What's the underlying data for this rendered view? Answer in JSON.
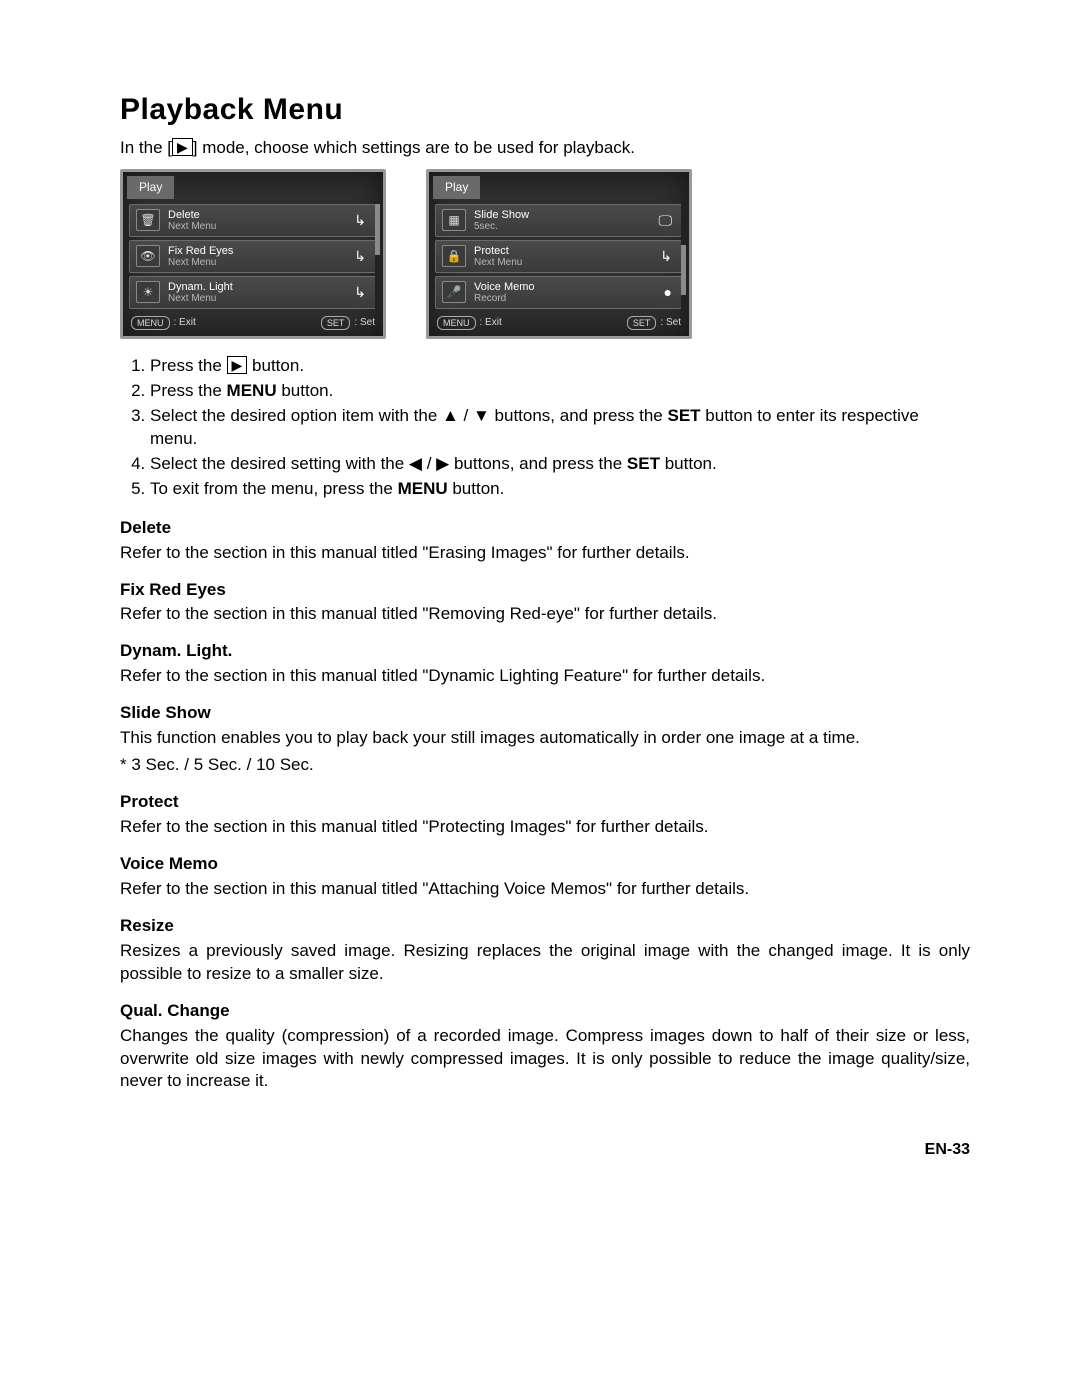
{
  "title": "Playback Menu",
  "intro_pre": "In the [",
  "intro_post": "] mode, choose which settings are to be used for playback.",
  "play_icon_glyph": "▶",
  "screens": {
    "tab": "Play",
    "left": [
      {
        "icon": "🗑",
        "title": "Delete",
        "sub": "Next Menu",
        "arrow": "↳"
      },
      {
        "icon": "👁",
        "title": "Fix Red Eyes",
        "sub": "Next Menu",
        "arrow": "↳"
      },
      {
        "icon": "☀",
        "title": "Dynam. Light",
        "sub": "Next Menu",
        "arrow": "↳"
      }
    ],
    "right": [
      {
        "icon": "▦",
        "title": "Slide Show",
        "sub": "5sec.",
        "arrow": "🖵"
      },
      {
        "icon": "🔒",
        "title": "Protect",
        "sub": "Next Menu",
        "arrow": "↳"
      },
      {
        "icon": "🎤",
        "title": "Voice Memo",
        "sub": "Record",
        "arrow": "●"
      }
    ],
    "footer": {
      "menu": "MENU",
      "exit": ": Exit",
      "set": "SET",
      "setlabel": ": Set"
    }
  },
  "steps": [
    {
      "pre": "Press the ",
      "icon": "▶",
      "post": " button."
    },
    {
      "text": "Press the MENU button.",
      "bold": [
        "MENU"
      ]
    },
    {
      "text": "Select the desired option item with the ▲ / ▼ buttons, and press the SET button to enter its respective menu.",
      "bold": [
        "SET"
      ]
    },
    {
      "text": "Select the desired setting with the ◀ / ▶ buttons, and press the SET button.",
      "bold": [
        "SET"
      ]
    },
    {
      "text": "To exit from the menu, press the MENU button.",
      "bold": [
        "MENU"
      ]
    }
  ],
  "sections": [
    {
      "title": "Delete",
      "body": "Refer to the section in this manual titled \"Erasing Images\" for further details."
    },
    {
      "title": "Fix Red Eyes",
      "body": "Refer to the section in this manual titled \"Removing Red-eye\" for further details."
    },
    {
      "title": "Dynam. Light.",
      "body": "Refer to the section in this manual titled \"Dynamic Lighting Feature\" for further details."
    },
    {
      "title": "Slide Show",
      "body": "This function enables you to play back your still images automatically in order one image at a time.",
      "options": "*  3 Sec. / 5 Sec. / 10 Sec."
    },
    {
      "title": "Protect",
      "body": "Refer to the section in this manual titled \"Protecting Images\" for further details."
    },
    {
      "title": "Voice Memo",
      "body": "Refer to the section in this manual titled \"Attaching Voice Memos\" for further details."
    },
    {
      "title": "Resize",
      "body": "Resizes a previously saved image. Resizing replaces the original image with the changed image. It is only possible to resize to a smaller size."
    },
    {
      "title": "Qual. Change",
      "body": "Changes the quality (compression) of a recorded image. Compress images down to half of their size or less, overwrite old size images with newly compressed images. It is only possible to reduce the image quality/size, never to increase it."
    }
  ],
  "page_number": "EN-33"
}
